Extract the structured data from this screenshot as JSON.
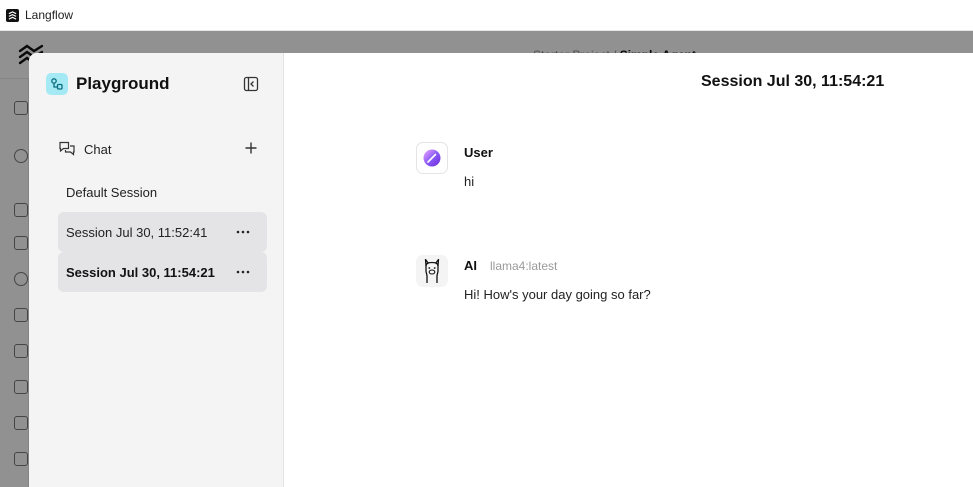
{
  "window": {
    "title": "Langflow"
  },
  "background": {
    "breadcrumb_prefix": "Starter Project /",
    "breadcrumb_flow": "Simple Agent"
  },
  "playground": {
    "title": "Playground",
    "chat_label": "Chat",
    "sessions": [
      {
        "label": "Default Session"
      },
      {
        "label": "Session Jul 30, 11:52:41"
      },
      {
        "label": "Session Jul 30, 11:54:21"
      }
    ]
  },
  "chat": {
    "session_title": "Session Jul 30, 11:54:21",
    "messages": [
      {
        "sender": "User",
        "text": "hi"
      },
      {
        "sender": "AI",
        "model": "llama4:latest",
        "text": "Hi! How's your day going so far?"
      }
    ]
  },
  "colors": {
    "accent_playground": "#a5e9f5",
    "selected_session": "#e4e4e7",
    "sidebar_bg": "#f4f4f5"
  }
}
